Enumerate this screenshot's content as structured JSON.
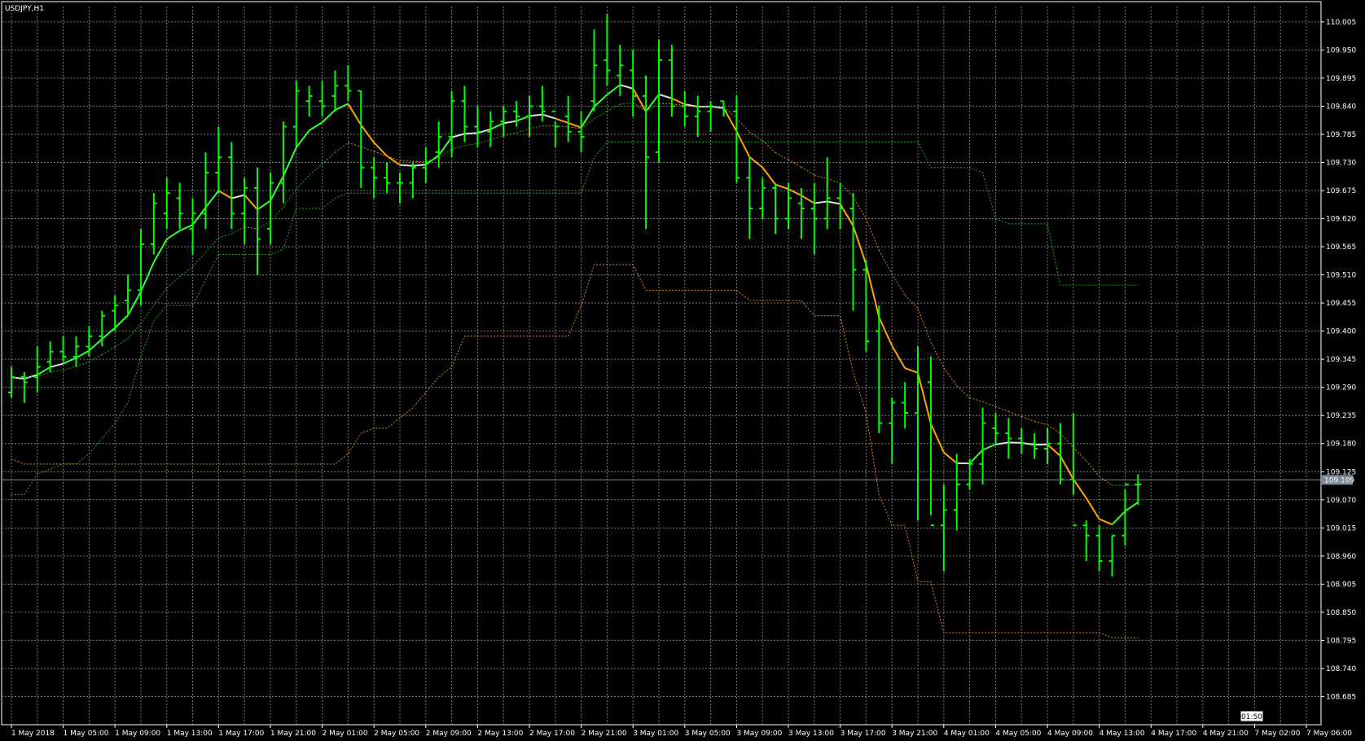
{
  "window": {
    "symbol_title": "USDJPY,H1"
  },
  "colors": {
    "background": "#000000",
    "grid": "#7a7a7a",
    "bars": "#00ff00",
    "ma_fast_up": "#33ff33",
    "ma_fast_flat": "#e0e0e0",
    "ma_fast_down": "#ffa500",
    "ma_slow_up": "#1faa1f",
    "ma_slow_down": "#d98b14",
    "band_upper": "#1faa1f",
    "band_lower": "#d98b14",
    "bid_line": "#7d8a99",
    "axis_text": "#ffffff"
  },
  "chart_data": {
    "type": "ohlc",
    "title": "USDJPY,H1",
    "ylim": [
      108.63,
      110.035
    ],
    "y_ticks": [
      "110.005",
      "109.950",
      "109.895",
      "109.840",
      "109.785",
      "109.730",
      "109.675",
      "109.620",
      "109.565",
      "109.510",
      "109.455",
      "109.400",
      "109.345",
      "109.290",
      "109.235",
      "109.180",
      "109.125",
      "109.070",
      "109.015",
      "108.960",
      "108.905",
      "108.850",
      "108.795",
      "108.740",
      "108.685"
    ],
    "x_ticks": [
      {
        "i": 0,
        "label": "1 May 2018"
      },
      {
        "i": 4,
        "label": "1 May 05:00"
      },
      {
        "i": 8,
        "label": "1 May 09:00"
      },
      {
        "i": 12,
        "label": "1 May 13:00"
      },
      {
        "i": 16,
        "label": "1 May 17:00"
      },
      {
        "i": 20,
        "label": "1 May 21:00"
      },
      {
        "i": 24,
        "label": "2 May 01:00"
      },
      {
        "i": 28,
        "label": "2 May 05:00"
      },
      {
        "i": 32,
        "label": "2 May 09:00"
      },
      {
        "i": 36,
        "label": "2 May 13:00"
      },
      {
        "i": 40,
        "label": "2 May 17:00"
      },
      {
        "i": 44,
        "label": "2 May 21:00"
      },
      {
        "i": 48,
        "label": "3 May 01:00"
      },
      {
        "i": 52,
        "label": "3 May 05:00"
      },
      {
        "i": 56,
        "label": "3 May 09:00"
      },
      {
        "i": 60,
        "label": "3 May 13:00"
      },
      {
        "i": 64,
        "label": "3 May 17:00"
      },
      {
        "i": 68,
        "label": "3 May 21:00"
      },
      {
        "i": 72,
        "label": "4 May 01:00"
      },
      {
        "i": 76,
        "label": "4 May 05:00"
      },
      {
        "i": 80,
        "label": "4 May 09:00"
      },
      {
        "i": 84,
        "label": "4 May 13:00"
      },
      {
        "i": 88,
        "label": "4 May 17:00"
      },
      {
        "i": 92,
        "label": "4 May 21:00"
      },
      {
        "i": 96,
        "label": "7 May 02:00"
      },
      {
        "i": 100,
        "label": "7 May 06:00"
      }
    ],
    "bid_price": 109.109,
    "bid_label": "109.109",
    "countdown": "01:50",
    "bars": [
      [
        109.28,
        109.33,
        109.27,
        109.31
      ],
      [
        109.31,
        109.32,
        109.26,
        109.3
      ],
      [
        109.31,
        109.37,
        109.28,
        109.33
      ],
      [
        109.34,
        109.38,
        109.32,
        109.36
      ],
      [
        109.36,
        109.39,
        109.34,
        109.35
      ],
      [
        109.35,
        109.39,
        109.33,
        109.37
      ],
      [
        109.37,
        109.41,
        109.35,
        109.39
      ],
      [
        109.39,
        109.44,
        109.37,
        109.43
      ],
      [
        109.44,
        109.47,
        109.4,
        109.45
      ],
      [
        109.46,
        109.51,
        109.43,
        109.48
      ],
      [
        109.48,
        109.6,
        109.45,
        109.57
      ],
      [
        109.57,
        109.67,
        109.55,
        109.65
      ],
      [
        109.63,
        109.7,
        109.6,
        109.67
      ],
      [
        109.66,
        109.69,
        109.6,
        109.63
      ],
      [
        109.6,
        109.66,
        109.55,
        109.63
      ],
      [
        109.63,
        109.75,
        109.6,
        109.71
      ],
      [
        109.71,
        109.8,
        109.67,
        109.74
      ],
      [
        109.74,
        109.77,
        109.6,
        109.63
      ],
      [
        109.63,
        109.7,
        109.57,
        109.68
      ],
      [
        109.68,
        109.72,
        109.51,
        109.58
      ],
      [
        109.6,
        109.71,
        109.57,
        109.69
      ],
      [
        109.69,
        109.81,
        109.65,
        109.8
      ],
      [
        109.8,
        109.89,
        109.76,
        109.87
      ],
      [
        109.85,
        109.88,
        109.82,
        109.86
      ],
      [
        109.85,
        109.89,
        109.82,
        109.84
      ],
      [
        109.86,
        109.91,
        109.83,
        109.88
      ],
      [
        109.88,
        109.92,
        109.85,
        109.87
      ],
      [
        109.87,
        109.87,
        109.68,
        109.72
      ],
      [
        109.72,
        109.74,
        109.66,
        109.7
      ],
      [
        109.7,
        109.73,
        109.67,
        109.69
      ],
      [
        109.69,
        109.71,
        109.65,
        109.69
      ],
      [
        109.69,
        109.73,
        109.66,
        109.72
      ],
      [
        109.72,
        109.76,
        109.69,
        109.73
      ],
      [
        109.75,
        109.81,
        109.72,
        109.78
      ],
      [
        109.78,
        109.87,
        109.74,
        109.85
      ],
      [
        109.85,
        109.88,
        109.77,
        109.8
      ],
      [
        109.8,
        109.84,
        109.76,
        109.79
      ],
      [
        109.79,
        109.83,
        109.76,
        109.81
      ],
      [
        109.81,
        109.84,
        109.78,
        109.83
      ],
      [
        109.83,
        109.85,
        109.8,
        109.82
      ],
      [
        109.82,
        109.86,
        109.78,
        109.84
      ],
      [
        109.84,
        109.88,
        109.81,
        109.83
      ],
      [
        109.83,
        109.81,
        109.76,
        109.8
      ],
      [
        109.82,
        109.86,
        109.77,
        109.79
      ],
      [
        109.79,
        109.83,
        109.75,
        109.78
      ],
      [
        109.85,
        109.99,
        109.83,
        109.92
      ],
      [
        109.93,
        110.02,
        109.88,
        109.91
      ],
      [
        109.9,
        109.96,
        109.86,
        109.92
      ],
      [
        109.91,
        109.95,
        109.82,
        109.86
      ],
      [
        109.86,
        109.9,
        109.6,
        109.74
      ],
      [
        109.75,
        109.97,
        109.73,
        109.93
      ],
      [
        109.93,
        109.96,
        109.82,
        109.84
      ],
      [
        109.84,
        109.87,
        109.8,
        109.82
      ],
      [
        109.82,
        109.86,
        109.78,
        109.83
      ],
      [
        109.83,
        109.85,
        109.79,
        109.84
      ],
      [
        109.85,
        109.85,
        109.82,
        109.83
      ],
      [
        109.83,
        109.86,
        109.69,
        109.7
      ],
      [
        109.7,
        109.74,
        109.58,
        109.64
      ],
      [
        109.64,
        109.7,
        109.62,
        109.68
      ],
      [
        109.68,
        109.69,
        109.59,
        109.62
      ],
      [
        109.62,
        109.69,
        109.6,
        109.66
      ],
      [
        109.65,
        109.68,
        109.58,
        109.64
      ],
      [
        109.64,
        109.69,
        109.55,
        109.62
      ],
      [
        109.62,
        109.74,
        109.6,
        109.66
      ],
      [
        109.66,
        109.69,
        109.6,
        109.64
      ],
      [
        109.64,
        109.67,
        109.44,
        109.52
      ],
      [
        109.52,
        109.54,
        109.36,
        109.38
      ],
      [
        109.4,
        109.45,
        109.2,
        109.22
      ],
      [
        109.22,
        109.27,
        109.14,
        109.26
      ],
      [
        109.26,
        109.3,
        109.21,
        109.24
      ],
      [
        109.24,
        109.37,
        109.03,
        109.3
      ],
      [
        109.3,
        109.35,
        109.04,
        109.02
      ],
      [
        109.02,
        109.1,
        108.93,
        109.05
      ],
      [
        109.05,
        109.16,
        109.01,
        109.1
      ],
      [
        109.1,
        109.15,
        109.09,
        109.14
      ],
      [
        109.14,
        109.25,
        109.1,
        109.22
      ],
      [
        109.21,
        109.24,
        109.18,
        109.2
      ],
      [
        109.2,
        109.23,
        109.15,
        109.19
      ],
      [
        109.19,
        109.21,
        109.16,
        109.18
      ],
      [
        109.18,
        109.2,
        109.15,
        109.17
      ],
      [
        109.17,
        109.21,
        109.14,
        109.18
      ],
      [
        109.18,
        109.22,
        109.1,
        109.11
      ],
      [
        109.11,
        109.24,
        109.08,
        109.02
      ],
      [
        109.02,
        109.03,
        108.95,
        109.0
      ],
      [
        109.0,
        109.02,
        108.93,
        108.95
      ],
      [
        108.95,
        109.0,
        108.92,
        109.0
      ],
      [
        109.0,
        109.09,
        108.98,
        109.1
      ],
      [
        109.1,
        109.12,
        109.06,
        109.1
      ]
    ],
    "ma_fast": [],
    "ma_slow": [],
    "band_upper": [],
    "band_lower": []
  }
}
